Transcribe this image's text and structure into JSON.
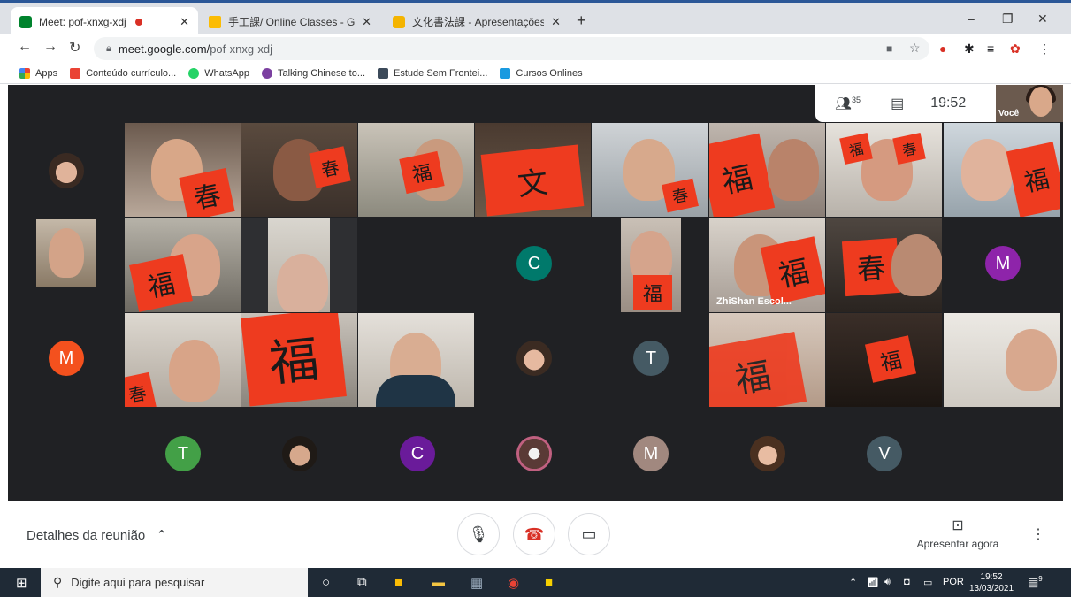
{
  "browser": {
    "tabs": [
      {
        "title": "Meet: pof-xnxg-xdj",
        "active": true
      },
      {
        "title": "手工課/ Online Classes - Google",
        "active": false
      },
      {
        "title": "文化書法課 - Apresentações Goo",
        "active": false
      }
    ],
    "url_domain": "meet.google.com/",
    "url_path": "pof-xnxg-xdj",
    "bookmarks": [
      "Apps",
      "Conteúdo currículo...",
      "WhatsApp",
      "Talking Chinese to...",
      "Estude Sem Frontei...",
      "Cursos Onlines"
    ]
  },
  "meet": {
    "participants_count": "35",
    "clock": "19:52",
    "self_label": "Você",
    "tiles": {
      "zhishan_name": "ZhiShan Escol..."
    },
    "avatars": {
      "c1": "C",
      "m1": "M",
      "m2": "M",
      "t1": "T",
      "t2": "T",
      "c2": "C",
      "m3": "M",
      "v1": "V"
    },
    "cards": {
      "chun": "春",
      "fu": "福",
      "wen": "文"
    }
  },
  "controls": {
    "details": "Detalhes da reunião",
    "present": "Apresentar agora"
  },
  "taskbar": {
    "search_placeholder": "Digite aqui para pesquisar",
    "lang": "POR",
    "time": "19:52",
    "date": "13/03/2021",
    "notif_count": "9"
  },
  "colors": {
    "meet_bg": "#202124",
    "avatar_green": "#00796b",
    "avatar_orange": "#f4511e",
    "avatar_purple": "#8e24aa",
    "avatar_slate": "#455a64",
    "avatar_lime": "#43a047",
    "avatar_brown": "#a1887f",
    "card_red": "#ee3b1f",
    "end_call": "#d93025"
  }
}
